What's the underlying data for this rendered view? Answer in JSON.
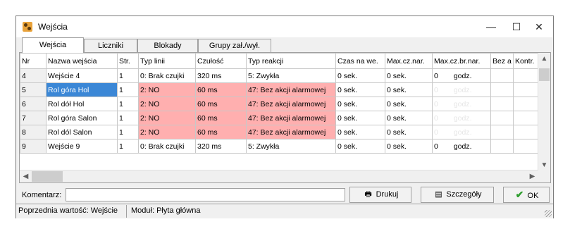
{
  "window": {
    "title": "Wejścia"
  },
  "tabs": [
    {
      "label": "Wejścia",
      "active": true
    },
    {
      "label": "Liczniki",
      "active": false
    },
    {
      "label": "Blokady",
      "active": false
    },
    {
      "label": "Grupy zał./wył.",
      "active": false
    }
  ],
  "grid": {
    "columns": [
      "Nr",
      "Nazwa wejścia",
      "Str.",
      "Typ linii",
      "Czułość",
      "Typ reakcji",
      "Czas na we.",
      "Max.cz.nar.",
      "Max.cz.br.nar.",
      "Bez a",
      "Kontr."
    ],
    "rows": [
      {
        "nr": "4",
        "name": "Wejście  4",
        "str": "1",
        "typ": "0: Brak czujki",
        "czul": "320 ms",
        "reakcja": "5: Zwykła",
        "czas": "0 sek.",
        "maxnar": "0 sek.",
        "maxbr": "0",
        "maxbr_unit": "godz.",
        "highlight": false
      },
      {
        "nr": "5",
        "name": "Rol góra Hol",
        "str": "1",
        "typ": "2: NO",
        "czul": "60 ms",
        "reakcja": "47: Bez akcji alarmowej",
        "czas": "0 sek.",
        "maxnar": "0 sek.",
        "maxbr": "0",
        "maxbr_unit": "godz.",
        "highlight": true
      },
      {
        "nr": "6",
        "name": "Rol dół  Hol",
        "str": "1",
        "typ": "2: NO",
        "czul": "60 ms",
        "reakcja": "47: Bez akcji alarmowej",
        "czas": "0 sek.",
        "maxnar": "0 sek.",
        "maxbr": "0",
        "maxbr_unit": "godz.",
        "highlight": true
      },
      {
        "nr": "7",
        "name": "Rol góra Salon",
        "str": "1",
        "typ": "2: NO",
        "czul": "60 ms",
        "reakcja": "47: Bez akcji alarmowej",
        "czas": "0 sek.",
        "maxnar": "0 sek.",
        "maxbr": "0",
        "maxbr_unit": "godz.",
        "highlight": true
      },
      {
        "nr": "8",
        "name": "Rol dól  Salon",
        "str": "1",
        "typ": "2: NO",
        "czul": "60 ms",
        "reakcja": "47: Bez akcji alarmowej",
        "czas": "0 sek.",
        "maxnar": "0 sek.",
        "maxbr": "0",
        "maxbr_unit": "godz.",
        "highlight": true
      },
      {
        "nr": "9",
        "name": "Wejście  9",
        "str": "1",
        "typ": "0: Brak czujki",
        "czul": "320 ms",
        "reakcja": "5: Zwykła",
        "czas": "0 sek.",
        "maxnar": "0 sek.",
        "maxbr": "0",
        "maxbr_unit": "godz.",
        "highlight": false
      }
    ]
  },
  "bottom": {
    "comment_label": "Komentarz:",
    "comment_value": "",
    "print_label": "Drukuj",
    "details_label": "Szczegóły",
    "ok_label": "OK"
  },
  "status": {
    "prev": "Poprzednia wartość: Wejście",
    "module": "Moduł: Płyta główna"
  },
  "colors": {
    "alarm_row": "#ffafaf",
    "selection": "#3b87d6",
    "ok_check": "#2e9e2e"
  }
}
